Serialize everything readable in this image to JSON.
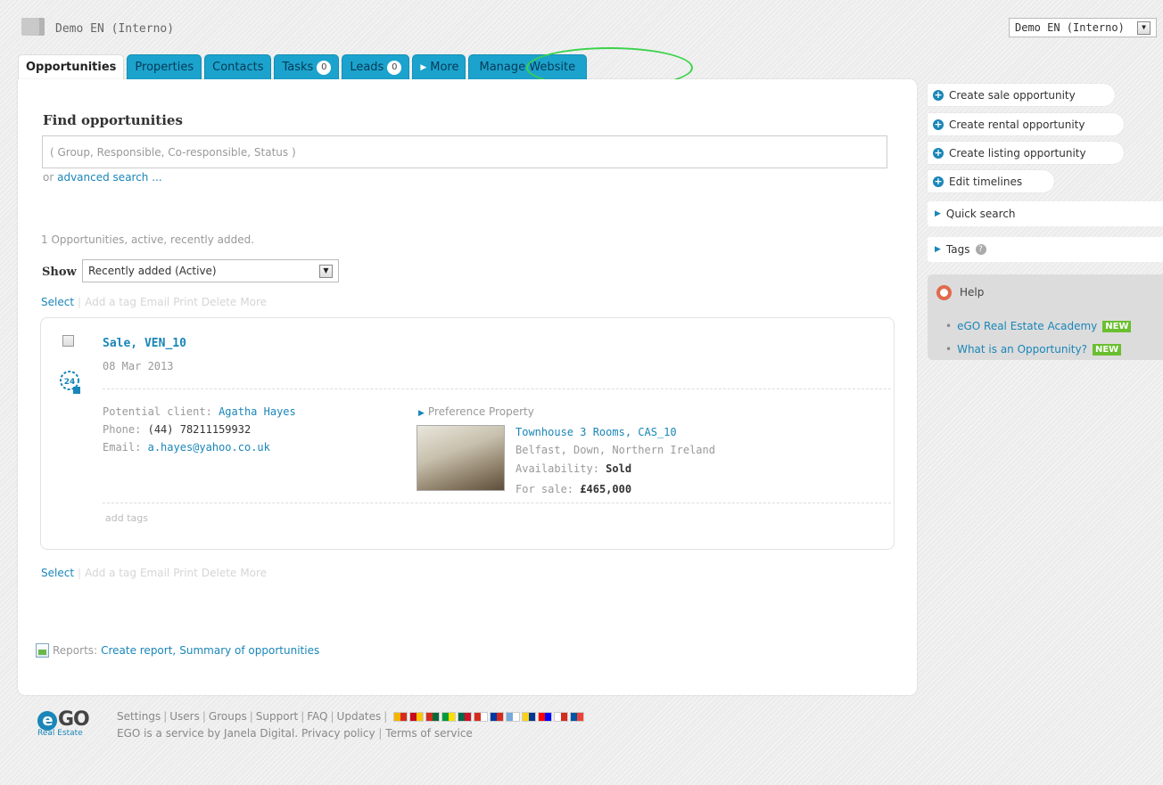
{
  "header": {
    "app_title": "Demo EN (Interno)",
    "account_select": "Demo EN (Interno)"
  },
  "tabs": [
    {
      "label": "Opportunities",
      "active": true
    },
    {
      "label": "Properties"
    },
    {
      "label": "Contacts"
    },
    {
      "label": "Tasks",
      "count": "0"
    },
    {
      "label": "Leads",
      "count": "0"
    },
    {
      "label": "More"
    },
    {
      "label": "Manage Website"
    }
  ],
  "search": {
    "title": "Find opportunities",
    "placeholder": "( Group, Responsible, Co-responsible, Status )",
    "or_text": "or",
    "advanced_link": "advanced search ..."
  },
  "summary": "1 Opportunities, active, recently added.",
  "show": {
    "label": "Show",
    "value": "Recently added (Active)"
  },
  "actions": {
    "select": "Select",
    "add_tag": "Add a tag",
    "email": "Email",
    "print": "Print",
    "delete": "Delete",
    "more": "More"
  },
  "opportunity": {
    "title": "Sale, VEN_10",
    "date": "08 Mar 2013",
    "client_label": "Potential client:",
    "client_name": "Agatha Hayes",
    "phone_label": "Phone:",
    "phone": "(44) 78211159932",
    "email_label": "Email:",
    "email": "a.hayes@yahoo.co.uk",
    "preference_label": "Preference Property",
    "property": {
      "name": "Townhouse 3 Rooms, CAS_10",
      "location": "Belfast, Down, Northern Ireland",
      "availability_label": "Availability:",
      "availability": "Sold",
      "price_label": "For sale:",
      "price": "£465,000"
    },
    "add_tags": "add tags"
  },
  "reports": {
    "label": "Reports:",
    "create": "Create report",
    "sep": ",",
    "summary": "Summary of opportunities"
  },
  "sidebar": {
    "create_sale": "Create sale opportunity",
    "create_rental": "Create rental opportunity",
    "create_listing": "Create listing opportunity",
    "edit_timelines": "Edit timelines",
    "quick_search": "Quick search",
    "tags": "Tags",
    "help_title": "Help",
    "help_links": [
      {
        "label": "eGO Real Estate Academy",
        "badge": "NEW"
      },
      {
        "label": "What is an Opportunity?",
        "badge": "NEW"
      }
    ]
  },
  "footer": {
    "links": [
      "Settings",
      "Users",
      "Groups",
      "Support",
      "FAQ",
      "Updates"
    ],
    "line2_a": "EGO is a service by Janela Digital.",
    "privacy": "Privacy policy",
    "terms": "Terms of service",
    "logo_e": "e",
    "logo_go": "GO",
    "logo_sub": "Real Estate",
    "flag_colors": [
      [
        "#f4b400",
        "#d52b1e"
      ],
      [
        "#c60b1e",
        "#ffc400"
      ],
      [
        "#d52b1e",
        "#046a38"
      ],
      [
        "#009c3b",
        "#ffdf00"
      ],
      [
        "#006847",
        "#ce1126"
      ],
      [
        "#d52b1e",
        "#ffffff"
      ],
      [
        "#0039a6",
        "#d52b1e"
      ],
      [
        "#75aadb",
        "#ffffff"
      ],
      [
        "#fcd116",
        "#003893"
      ],
      [
        "#ff0000",
        "#0000ff"
      ],
      [
        "#ffffff",
        "#d52b1e"
      ],
      [
        "#0055a4",
        "#ef4135"
      ]
    ]
  }
}
